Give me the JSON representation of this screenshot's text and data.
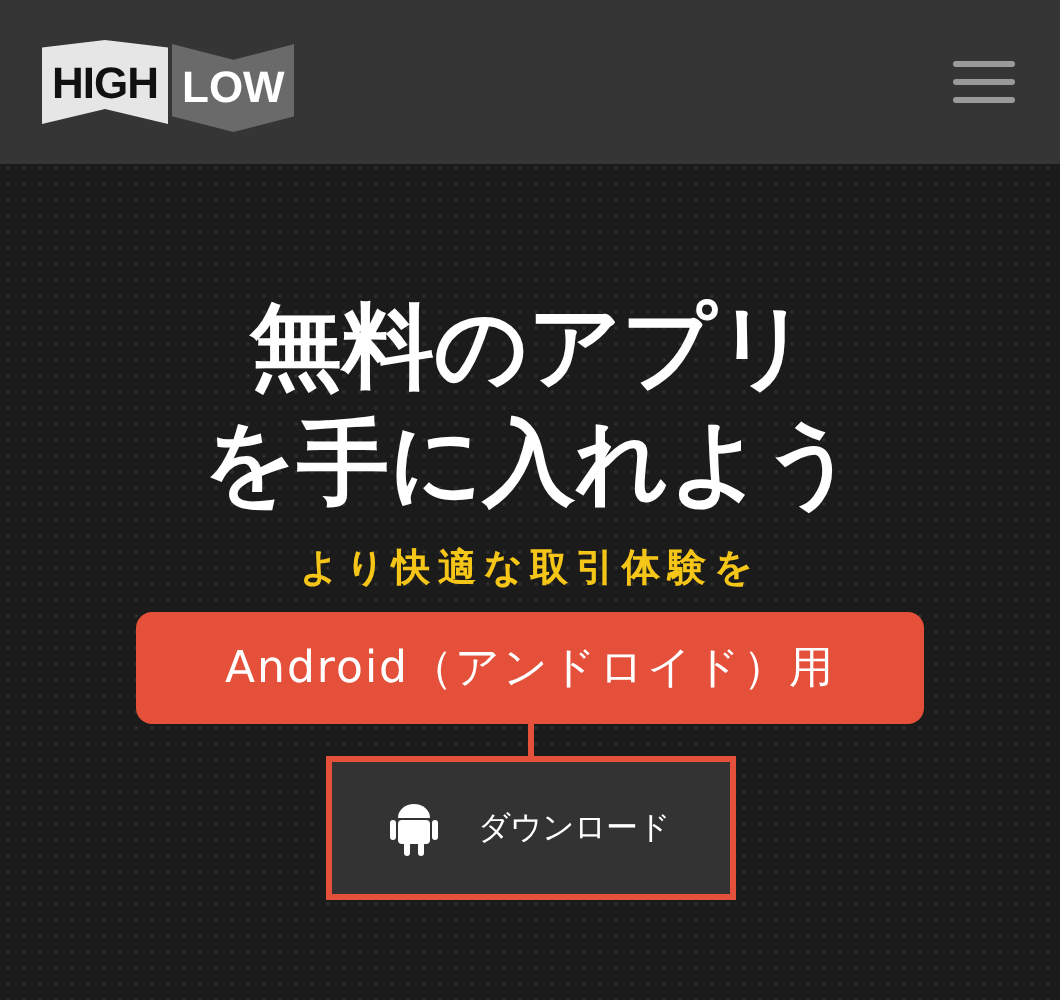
{
  "header": {
    "logo": {
      "high": "HIGH",
      "low": "LOW"
    }
  },
  "hero": {
    "title_lines": [
      "無料のアプリ",
      "を手に入れよう"
    ],
    "subtitle": "より快適な取引体験を"
  },
  "callout": {
    "label": "Android（アンドロイド）用"
  },
  "download_button": {
    "label": "ダウンロード"
  }
}
